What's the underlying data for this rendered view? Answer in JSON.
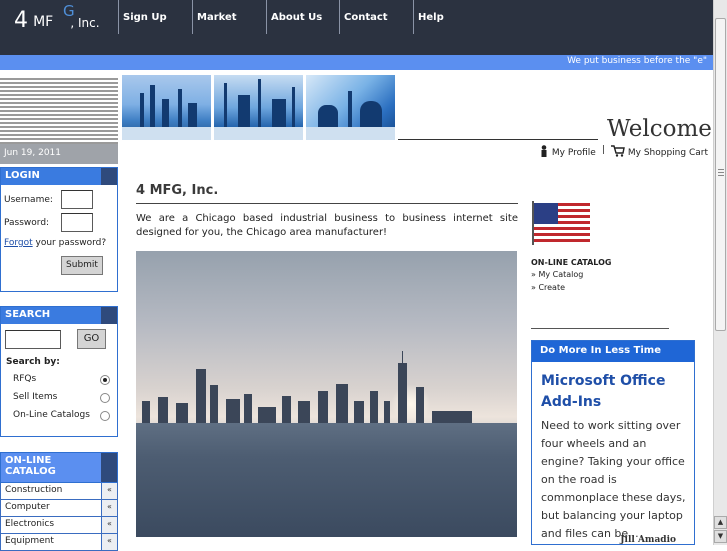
{
  "logo": {
    "prefix": "4",
    "mid": "MF",
    "gear": "G",
    "suffix": ", Inc."
  },
  "nav": [
    "Sign Up",
    "Market",
    "About Us",
    "Contact",
    "Help"
  ],
  "tagline": "We put business before the \"e\"",
  "date": "Jun 19, 2011",
  "login": {
    "title": "LOGIN",
    "username_label": "Username:",
    "password_label": "Password:",
    "forgot_link": "Forgot",
    "forgot_rest": " your password?",
    "submit": "Submit"
  },
  "search": {
    "title": "SEARCH",
    "go": "GO",
    "search_by": "Search by:",
    "options": [
      {
        "label": "RFQs",
        "selected": true
      },
      {
        "label": "Sell Items",
        "selected": false
      },
      {
        "label": "On-Line Catalogs",
        "selected": false
      }
    ]
  },
  "catalog_panel": {
    "title_line1": "ON-LINE",
    "title_line2": "CATALOG",
    "items": [
      "Construction",
      "Computer",
      "Electronics",
      "Equipment"
    ],
    "arrow": "«"
  },
  "header": {
    "welcome": "Welcome",
    "my_profile": "My Profile",
    "separator": "|",
    "shopping_cart": "My Shopping Cart"
  },
  "main": {
    "heading": "4 MFG, Inc.",
    "intro": "We are a Chicago based industrial business to business internet site designed for you, the Chicago area manufacturer!"
  },
  "right": {
    "catalog_heading": "ON-LINE CATALOG",
    "links": [
      "» My Catalog",
      "» Create"
    ]
  },
  "ad": {
    "header": "Do More In Less Time",
    "title": "Microsoft Office Add-Ins",
    "body": "Need to work sitting over four wheels and an engine? Taking your office on the road is commonplace these days, but balancing your laptop and files can be...",
    "author": "Jill Amadio"
  },
  "colors": {
    "nav_bg": "#2b3240",
    "accent_blue": "#5b8ff0",
    "panel_blue": "#3a7be0"
  }
}
